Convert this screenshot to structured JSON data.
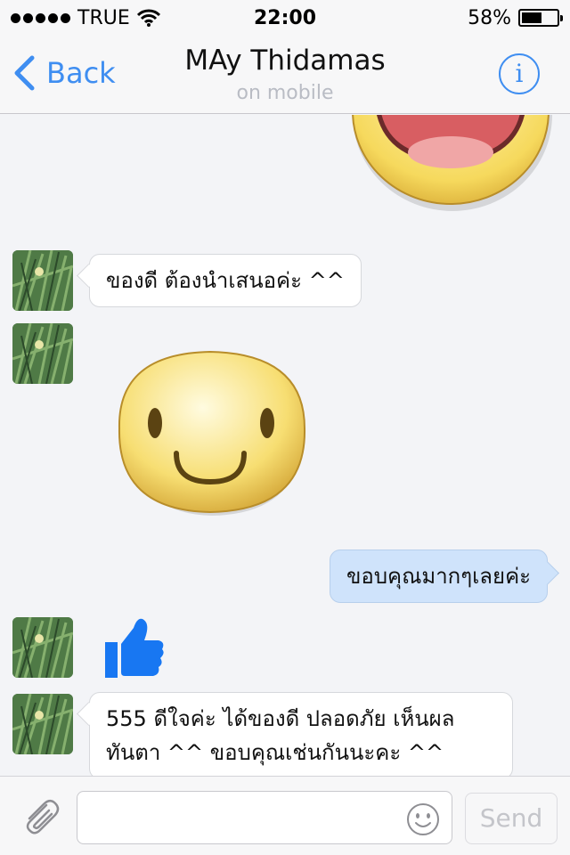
{
  "status_bar": {
    "carrier": "TRUE",
    "time": "22:00",
    "battery_percent": "58%",
    "battery_level": 0.58
  },
  "nav": {
    "back_label": "Back",
    "title": "MAy Thidamas",
    "subtitle": "on mobile",
    "info_label": "i"
  },
  "messages": [
    {
      "type": "sticker",
      "direction": "outgoing",
      "sticker": "laughing-face-sticker"
    },
    {
      "type": "text",
      "direction": "incoming",
      "text": "ของดี ต้องนำเสนอค่ะ ^^"
    },
    {
      "type": "sticker",
      "direction": "incoming",
      "sticker": "smiling-face-sticker"
    },
    {
      "type": "text",
      "direction": "outgoing",
      "text": "ขอบคุณมากๆเลยค่ะ"
    },
    {
      "type": "like",
      "direction": "incoming",
      "icon": "thumbs-up-icon"
    },
    {
      "type": "text",
      "direction": "incoming",
      "lines": [
        "555 ดีใจค่ะ ได้ของดี ปลอดภัย เห็นผล",
        "ทันตา ^^ ขอบคุณเช่นกันนะคะ ^^"
      ]
    }
  ],
  "composer": {
    "input_value": "",
    "input_placeholder": "",
    "send_label": "Send"
  },
  "colors": {
    "accent": "#3f8ef1",
    "outgoing_bubble": "#cfe3fb",
    "incoming_bubble": "#ffffff",
    "background": "#f3f4f7",
    "like_blue": "#1877f2"
  }
}
